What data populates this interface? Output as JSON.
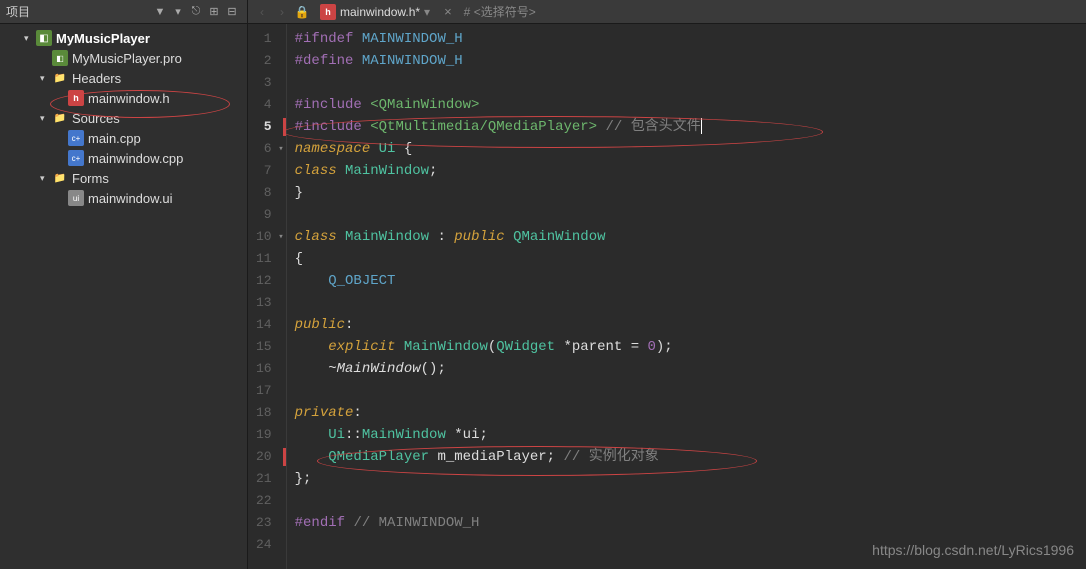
{
  "sidebar": {
    "title": "项目",
    "tree": {
      "project": "MyMusicPlayer",
      "pro_file": "MyMusicPlayer.pro",
      "headers": "Headers",
      "header_file": "mainwindow.h",
      "sources": "Sources",
      "source_files": [
        "main.cpp",
        "mainwindow.cpp"
      ],
      "forms": "Forms",
      "form_file": "mainwindow.ui"
    }
  },
  "tabs": {
    "filename": "mainwindow.h*",
    "symbol_prefix": "#",
    "symbol_placeholder": "<选择符号>"
  },
  "code": {
    "lines": [
      {
        "n": 1,
        "tokens": [
          [
            "preproc",
            "#ifndef"
          ],
          [
            "sp",
            " "
          ],
          [
            "macro",
            "MAINWINDOW_H"
          ]
        ]
      },
      {
        "n": 2,
        "tokens": [
          [
            "preproc",
            "#define"
          ],
          [
            "sp",
            " "
          ],
          [
            "macro",
            "MAINWINDOW_H"
          ]
        ]
      },
      {
        "n": 3,
        "tokens": []
      },
      {
        "n": 4,
        "tokens": [
          [
            "preproc",
            "#include"
          ],
          [
            "sp",
            " "
          ],
          [
            "string",
            "<QMainWindow>"
          ]
        ]
      },
      {
        "n": 5,
        "mod": true,
        "current": true,
        "tokens": [
          [
            "preproc",
            "#include"
          ],
          [
            "sp",
            " "
          ],
          [
            "string",
            "<QtMultimedia/QMediaPlayer>"
          ],
          [
            "sp",
            " "
          ],
          [
            "comment",
            "// 包含头文件"
          ],
          [
            "cursor",
            ""
          ]
        ]
      },
      {
        "n": 6,
        "fold": true,
        "tokens": [
          [
            "keyword",
            "namespace"
          ],
          [
            "sp",
            " "
          ],
          [
            "type",
            "Ui"
          ],
          [
            "sp",
            " "
          ],
          [
            "ident",
            "{"
          ]
        ]
      },
      {
        "n": 7,
        "tokens": [
          [
            "keyword",
            "class"
          ],
          [
            "sp",
            " "
          ],
          [
            "type",
            "MainWindow"
          ],
          [
            "ident",
            ";"
          ]
        ]
      },
      {
        "n": 8,
        "tokens": [
          [
            "ident",
            "}"
          ]
        ]
      },
      {
        "n": 9,
        "tokens": []
      },
      {
        "n": 10,
        "fold": true,
        "tokens": [
          [
            "keyword",
            "class"
          ],
          [
            "sp",
            " "
          ],
          [
            "type",
            "MainWindow"
          ],
          [
            "sp",
            " "
          ],
          [
            "ident",
            ":"
          ],
          [
            "sp",
            " "
          ],
          [
            "keyword",
            "public"
          ],
          [
            "sp",
            " "
          ],
          [
            "type",
            "QMainWindow"
          ]
        ]
      },
      {
        "n": 11,
        "tokens": [
          [
            "ident",
            "{"
          ]
        ]
      },
      {
        "n": 12,
        "tokens": [
          [
            "sp",
            "    "
          ],
          [
            "macro",
            "Q_OBJECT"
          ]
        ]
      },
      {
        "n": 13,
        "tokens": []
      },
      {
        "n": 14,
        "tokens": [
          [
            "keyword",
            "public"
          ],
          [
            "ident",
            ":"
          ]
        ]
      },
      {
        "n": 15,
        "tokens": [
          [
            "sp",
            "    "
          ],
          [
            "keyword",
            "explicit"
          ],
          [
            "sp",
            " "
          ],
          [
            "type",
            "MainWindow"
          ],
          [
            "ident",
            "("
          ],
          [
            "type",
            "QWidget"
          ],
          [
            "sp",
            " "
          ],
          [
            "ident",
            "*parent = "
          ],
          [
            "num",
            "0"
          ],
          [
            "ident",
            ");"
          ]
        ]
      },
      {
        "n": 16,
        "tokens": [
          [
            "sp",
            "    "
          ],
          [
            "ident",
            "~"
          ],
          [
            "func",
            "MainWindow"
          ],
          [
            "ident",
            "();"
          ]
        ]
      },
      {
        "n": 17,
        "tokens": []
      },
      {
        "n": 18,
        "tokens": [
          [
            "keyword",
            "private"
          ],
          [
            "ident",
            ":"
          ]
        ]
      },
      {
        "n": 19,
        "tokens": [
          [
            "sp",
            "    "
          ],
          [
            "type",
            "Ui"
          ],
          [
            "ident",
            "::"
          ],
          [
            "type",
            "MainWindow"
          ],
          [
            "sp",
            " "
          ],
          [
            "ident",
            "*ui;"
          ]
        ]
      },
      {
        "n": 20,
        "mod": true,
        "tokens": [
          [
            "sp",
            "    "
          ],
          [
            "type",
            "QMediaPlayer"
          ],
          [
            "sp",
            " "
          ],
          [
            "ident",
            "m_mediaPlayer; "
          ],
          [
            "comment",
            "// 实例化对象"
          ]
        ]
      },
      {
        "n": 21,
        "tokens": [
          [
            "ident",
            "};"
          ]
        ]
      },
      {
        "n": 22,
        "tokens": []
      },
      {
        "n": 23,
        "tokens": [
          [
            "preproc",
            "#endif"
          ],
          [
            "sp",
            " "
          ],
          [
            "comment",
            "// MAINWINDOW_H"
          ]
        ]
      },
      {
        "n": 24,
        "tokens": []
      }
    ]
  },
  "watermark": "https://blog.csdn.net/LyRics1996"
}
